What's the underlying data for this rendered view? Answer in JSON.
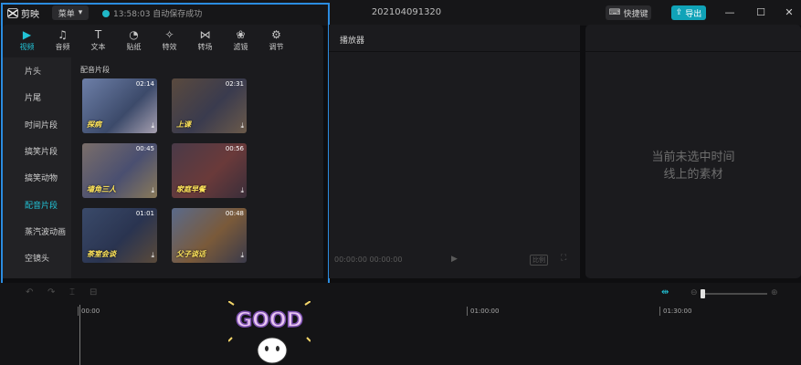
{
  "titlebar": {
    "app_name": "剪映",
    "menu_label": "菜单",
    "save_status": "13:58:03 自动保存成功",
    "project_title": "202104091320",
    "shortcut_label": "快捷键",
    "export_label": "导出",
    "window_controls": [
      "—",
      "☐",
      "✕"
    ]
  },
  "media": {
    "tabs": [
      {
        "label": "视频",
        "icon": "video-icon"
      },
      {
        "label": "音频",
        "icon": "audio-icon"
      },
      {
        "label": "文本",
        "icon": "text-icon"
      },
      {
        "label": "贴纸",
        "icon": "sticker-icon"
      },
      {
        "label": "特效",
        "icon": "effects-icon"
      },
      {
        "label": "转场",
        "icon": "transition-icon"
      },
      {
        "label": "滤镜",
        "icon": "filter-icon"
      },
      {
        "label": "调节",
        "icon": "adjust-icon"
      }
    ],
    "sidebar": [
      "片头",
      "片尾",
      "时间片段",
      "搞笑片段",
      "搞笑动物",
      "配音片段",
      "蒸汽波动画",
      "空镜头"
    ],
    "active_sidebar": "配音片段",
    "section_title": "配音片段",
    "clips": [
      {
        "duration": "02:14",
        "caption": "探病"
      },
      {
        "duration": "02:31",
        "caption": "上课"
      },
      {
        "duration": "00:45",
        "caption": "墙角三人"
      },
      {
        "duration": "00:56",
        "caption": "家庭早餐"
      },
      {
        "duration": "01:01",
        "caption": "茶室会谈"
      },
      {
        "duration": "00:48",
        "caption": "父子谈话"
      }
    ]
  },
  "player": {
    "title": "播放器",
    "time": "00:00:00  00:00:00",
    "ratio_label": "比例"
  },
  "inspector": {
    "empty_line1": "当前未选中时间",
    "empty_line2": "线上的素材"
  },
  "timeline": {
    "ticks": [
      "00:00",
      "01:00:00",
      "01:30:00"
    ],
    "sticker_text": "GOOD"
  },
  "colors": {
    "accent": "#22c3d6",
    "export_bg": "#10a3b8",
    "highlight": "#2b8ce0"
  }
}
